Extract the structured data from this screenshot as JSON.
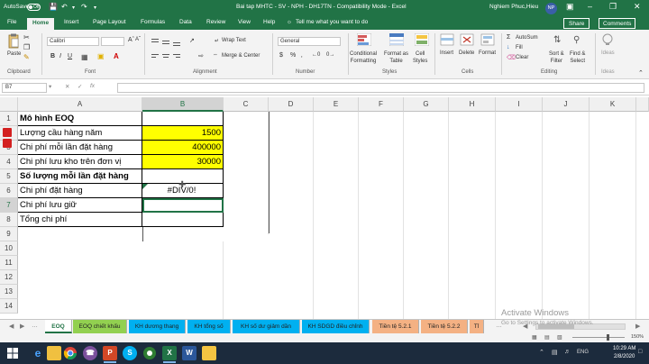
{
  "titlebar": {
    "autosave_label": "AutoSave",
    "autosave_state": "Off",
    "file_title": "Bai tap MHTC - SV - NPH - DH17TN  -  Compatibility Mode  -  Excel",
    "user_name": "Nghiem Phuc,Hieu",
    "user_initials": "NP"
  },
  "ribbon_tabs": [
    "File",
    "Home",
    "Insert",
    "Page Layout",
    "Formulas",
    "Data",
    "Review",
    "View",
    "Help",
    "Tell me what you want to do"
  ],
  "ribbon_actions": {
    "share": "Share",
    "comments": "Comments"
  },
  "ribbon": {
    "paste": "Paste",
    "clipboard": "Clipboard",
    "font_name": "Calibri",
    "font": "Font",
    "wrap_text": "Wrap Text",
    "merge_center": "Merge & Center",
    "alignment": "Alignment",
    "number_format": "General",
    "number": "Number",
    "conditional_formatting": "Conditional\nFormatting",
    "format_as_table": "Format as\nTable",
    "cell_styles": "Cell\nStyles",
    "styles": "Styles",
    "insert": "Insert",
    "delete": "Delete",
    "format": "Format",
    "cells": "Cells",
    "autosum": "AutoSum",
    "fill": "Fill",
    "clear": "Clear",
    "sort_filter": "Sort &\nFilter",
    "find_select": "Find &\nSelect",
    "editing": "Editing",
    "ideas": "Ideas"
  },
  "formula_bar": {
    "name_box": "B7",
    "fx": "fx",
    "formula": ""
  },
  "columns": [
    "A",
    "B",
    "C",
    "D",
    "E",
    "F",
    "G",
    "H",
    "I",
    "J",
    "K"
  ],
  "rows": [
    "1",
    "2",
    "3",
    "4",
    "5",
    "6",
    "7",
    "8",
    "9",
    "10",
    "11",
    "12",
    "13",
    "14"
  ],
  "cells": {
    "A1": "Mô hình EOQ",
    "A2": "Lượng cầu hàng năm",
    "A3": "Chi phí mỗi lần đặt hàng",
    "A4": "Chi phí lưu kho trên đơn vị",
    "A5": "Số lượng mỗi lần đặt hàng",
    "A6": "Chi phí đặt hàng",
    "A7": "Chi phí lưu giữ",
    "A8": "Tổng chi phí",
    "B2": "1500",
    "B3": "400000",
    "B4": "30000",
    "B6": "#DIV/0!"
  },
  "highlight_color": "#ffff00",
  "accent_color": "#217346",
  "sheet_tabs": [
    {
      "label": "EOQ",
      "color": "#ffffff",
      "active": true
    },
    {
      "label": "EOQ chiết khấu",
      "color": "#92d050"
    },
    {
      "label": "KH dương thang",
      "color": "#00b0f0"
    },
    {
      "label": "KH tổng số",
      "color": "#00b0f0"
    },
    {
      "label": "KH số dư giảm dần",
      "color": "#00b0f0"
    },
    {
      "label": "KH SDGD điều chỉnh",
      "color": "#00b0f0"
    },
    {
      "label": "Tiền tệ 5.2.1",
      "color": "#f4b183"
    },
    {
      "label": "Tiền tệ 5.2.2",
      "color": "#f4b183"
    },
    {
      "label": "Tỉ",
      "color": "#f4b183"
    }
  ],
  "watermark": {
    "line1": "Activate Windows",
    "line2": "Go to Settings to activate Windows."
  },
  "status": {
    "zoom": "150%"
  },
  "taskbar": {
    "apps": [
      "start-icon",
      "ie-icon",
      "explorer-icon",
      "chrome-icon",
      "viber-icon",
      "powerpoint-icon",
      "skype-icon",
      "coccoc-icon",
      "excel-icon",
      "word-icon",
      "folder-icon"
    ],
    "time": "10:29 AM",
    "date": "2/8/2020"
  }
}
